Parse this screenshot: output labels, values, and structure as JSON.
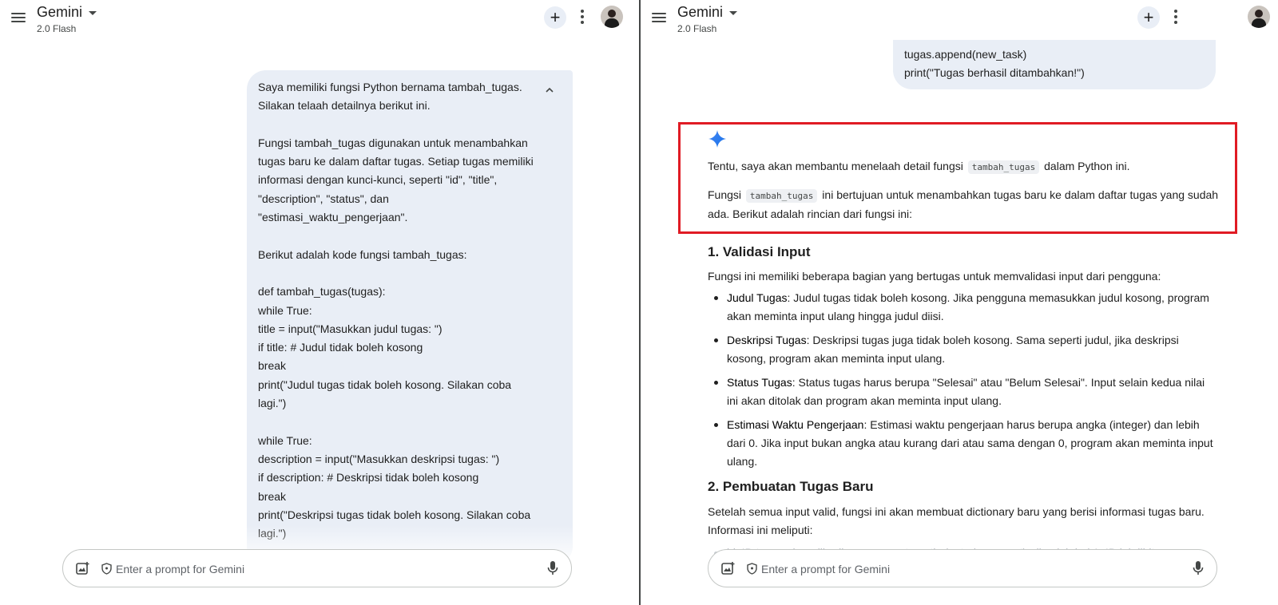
{
  "header": {
    "title": "Gemini",
    "model": "2.0 Flash"
  },
  "input": {
    "placeholder": "Enter a prompt for Gemini"
  },
  "left": {
    "user_message_lines": [
      "Saya memiliki fungsi Python bernama tambah_tugas.",
      "Silakan telaah detailnya berikut ini.",
      "",
      "Fungsi tambah_tugas digunakan untuk menambahkan",
      "tugas baru ke dalam daftar tugas. Setiap tugas memiliki",
      "informasi dengan kunci-kunci, seperti \"id\", \"title\",",
      "\"description\", \"status\", dan",
      "\"estimasi_waktu_pengerjaan\".",
      "",
      "Berikut adalah kode fungsi tambah_tugas:",
      "",
      "def tambah_tugas(tugas):",
      "while True:",
      "title = input(\"Masukkan judul tugas: \")",
      "if title: # Judul tidak boleh kosong",
      "break",
      "print(\"Judul tugas tidak boleh kosong. Silakan coba",
      "lagi.\")",
      "",
      "while True:",
      "description = input(\"Masukkan deskripsi tugas: \")",
      "if description: # Deskripsi tidak boleh kosong",
      "break",
      "print(\"Deskripsi tugas tidak boleh kosong. Silakan coba",
      "lagi.\")"
    ]
  },
  "right": {
    "user_message_tail": [
      "tugas.append(new_task)",
      "print(\"Tugas berhasil ditambahkan!\")"
    ],
    "intro": {
      "p1_before": "Tentu, saya akan membantu menelaah detail fungsi",
      "p1_code": "tambah_tugas",
      "p1_after": "dalam Python ini.",
      "p2_before": "Fungsi",
      "p2_code": "tambah_tugas",
      "p2_after": "ini bertujuan untuk menambahkan tugas baru ke dalam daftar tugas yang sudah ada. Berikut adalah rincian dari fungsi ini:"
    },
    "section1": {
      "heading": "1. Validasi Input",
      "intro": "Fungsi ini memiliki beberapa bagian yang bertugas untuk memvalidasi input dari pengguna:",
      "items": [
        {
          "term": "Judul Tugas",
          "text": ": Judul tugas tidak boleh kosong. Jika pengguna memasukkan judul kosong, program akan meminta input ulang hingga judul diisi."
        },
        {
          "term": "Deskripsi Tugas",
          "text": ": Deskripsi tugas juga tidak boleh kosong. Sama seperti judul, jika deskripsi kosong, program akan meminta input ulang."
        },
        {
          "term": "Status Tugas",
          "text": ": Status tugas harus berupa \"Selesai\" atau \"Belum Selesai\". Input selain kedua nilai ini akan ditolak dan program akan meminta input ulang."
        },
        {
          "term": "Estimasi Waktu Pengerjaan",
          "text": ": Estimasi waktu pengerjaan harus berupa angka (integer) dan lebih dari 0. Jika input bukan angka atau kurang dari atau sama dengan 0, program akan meminta input ulang."
        }
      ]
    },
    "section2": {
      "heading": "2. Pembuatan Tugas Baru",
      "intro": "Setelah semua input valid, fungsi ini akan membuat dictionary baru yang berisi informasi tugas baru. Informasi ini meliputi:",
      "faded_item": "id: ID tugas akan diberikan secara otomatis (auto-increment), dimulai dari 1. ID ini dihitung"
    }
  }
}
